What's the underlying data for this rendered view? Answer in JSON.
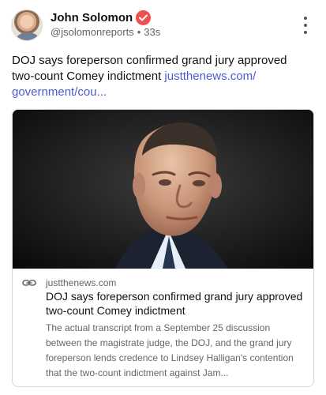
{
  "post": {
    "author": {
      "name": "John Solomon",
      "handle": "@jsolomonreports",
      "time": "33s",
      "verified_icon": "verified-badge-icon"
    },
    "text": "DOJ says foreperson confirmed grand jury approved two-count Comey indictment",
    "inline_link": "justthenews.com/\ngovernment/cou...",
    "menu_icon": "more-vertical-icon"
  },
  "link_card": {
    "domain": "justthenews.com",
    "title": "DOJ says foreperson confirmed grand jury approved two-count Comey indictment",
    "description": "The actual transcript from a September 25 discussion between the magistrate judge, the DOJ, and the grand jury foreperson lends credence to Lindsey Halligan's contention that the two-count indictment against Jam...",
    "link_icon": "link-icon"
  },
  "colors": {
    "accent_link": "#4c5bd4",
    "verified_red": "#ef4f4f",
    "muted_text": "#5f6368"
  }
}
